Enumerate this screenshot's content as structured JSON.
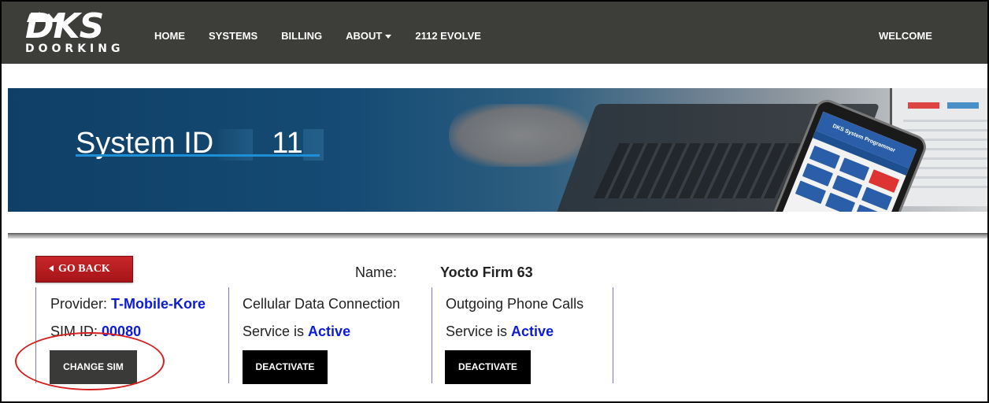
{
  "logo": {
    "brand": "DKS",
    "sub": "DOORKING"
  },
  "nav": {
    "items": [
      {
        "label": "HOME"
      },
      {
        "label": "SYSTEMS"
      },
      {
        "label": "BILLING"
      },
      {
        "label": "ABOUT"
      },
      {
        "label": "2112 EVOLVE"
      }
    ],
    "welcome": "WELCOME"
  },
  "banner": {
    "title": "System ID",
    "id_visible": "11",
    "phone_app_title": "DKS System Programmer"
  },
  "actions": {
    "go_back": "GO BACK"
  },
  "system": {
    "name_label": "Name:",
    "name_value": "Yocto Firm 63"
  },
  "sim": {
    "provider_label": "Provider:",
    "provider_value": "T-Mobile-Kore",
    "sim_id_label": "SIM ID:",
    "sim_id_value": "00080",
    "change_button": "CHANGE SIM"
  },
  "cellular": {
    "title": "Cellular Data Connection",
    "status_label": "Service is",
    "status_value": "Active",
    "button": "DEACTIVATE"
  },
  "phone_calls": {
    "title": "Outgoing Phone Calls",
    "status_label": "Service is",
    "status_value": "Active",
    "button": "DEACTIVATE"
  },
  "colors": {
    "navbar": "#3d3d39",
    "accent_text": "#0b1bd8",
    "go_back": "#b31c1f",
    "annotation": "#d42020"
  }
}
